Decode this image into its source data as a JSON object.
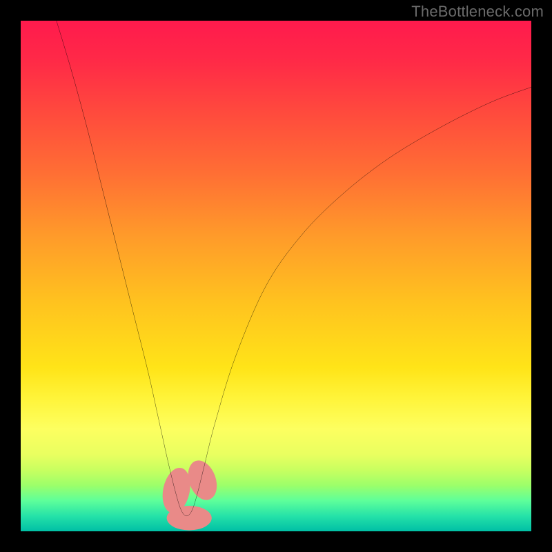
{
  "watermark": "TheBottleneck.com",
  "chart_data": {
    "type": "line",
    "title": "",
    "xlabel": "",
    "ylabel": "",
    "xlim": [
      0,
      100
    ],
    "ylim": [
      0,
      100
    ],
    "series": [
      {
        "name": "curve",
        "x": [
          7,
          10,
          13,
          16,
          19,
          22,
          25,
          27,
          29,
          30.5,
          31.5,
          32.5,
          33.5,
          34.5,
          36,
          38,
          42,
          48,
          55,
          63,
          72,
          82,
          92,
          100
        ],
        "y": [
          100,
          90,
          79,
          67,
          55,
          43,
          31,
          22,
          13,
          7,
          4,
          3,
          4,
          7,
          13,
          21,
          34,
          48,
          58,
          66,
          73,
          79,
          84,
          87
        ]
      }
    ],
    "markers": [
      {
        "name": "blob-left",
        "x": 30.5,
        "y": 8,
        "rx": 2.6,
        "ry": 4.5,
        "rot": 12,
        "fill": "#e98a88"
      },
      {
        "name": "blob-bottom",
        "x": 33.0,
        "y": 2.6,
        "rx": 4.4,
        "ry": 2.4,
        "rot": 0,
        "fill": "#e98a88"
      },
      {
        "name": "blob-right",
        "x": 35.6,
        "y": 10,
        "rx": 2.6,
        "ry": 4.0,
        "rot": -20,
        "fill": "#e98a88"
      }
    ]
  }
}
